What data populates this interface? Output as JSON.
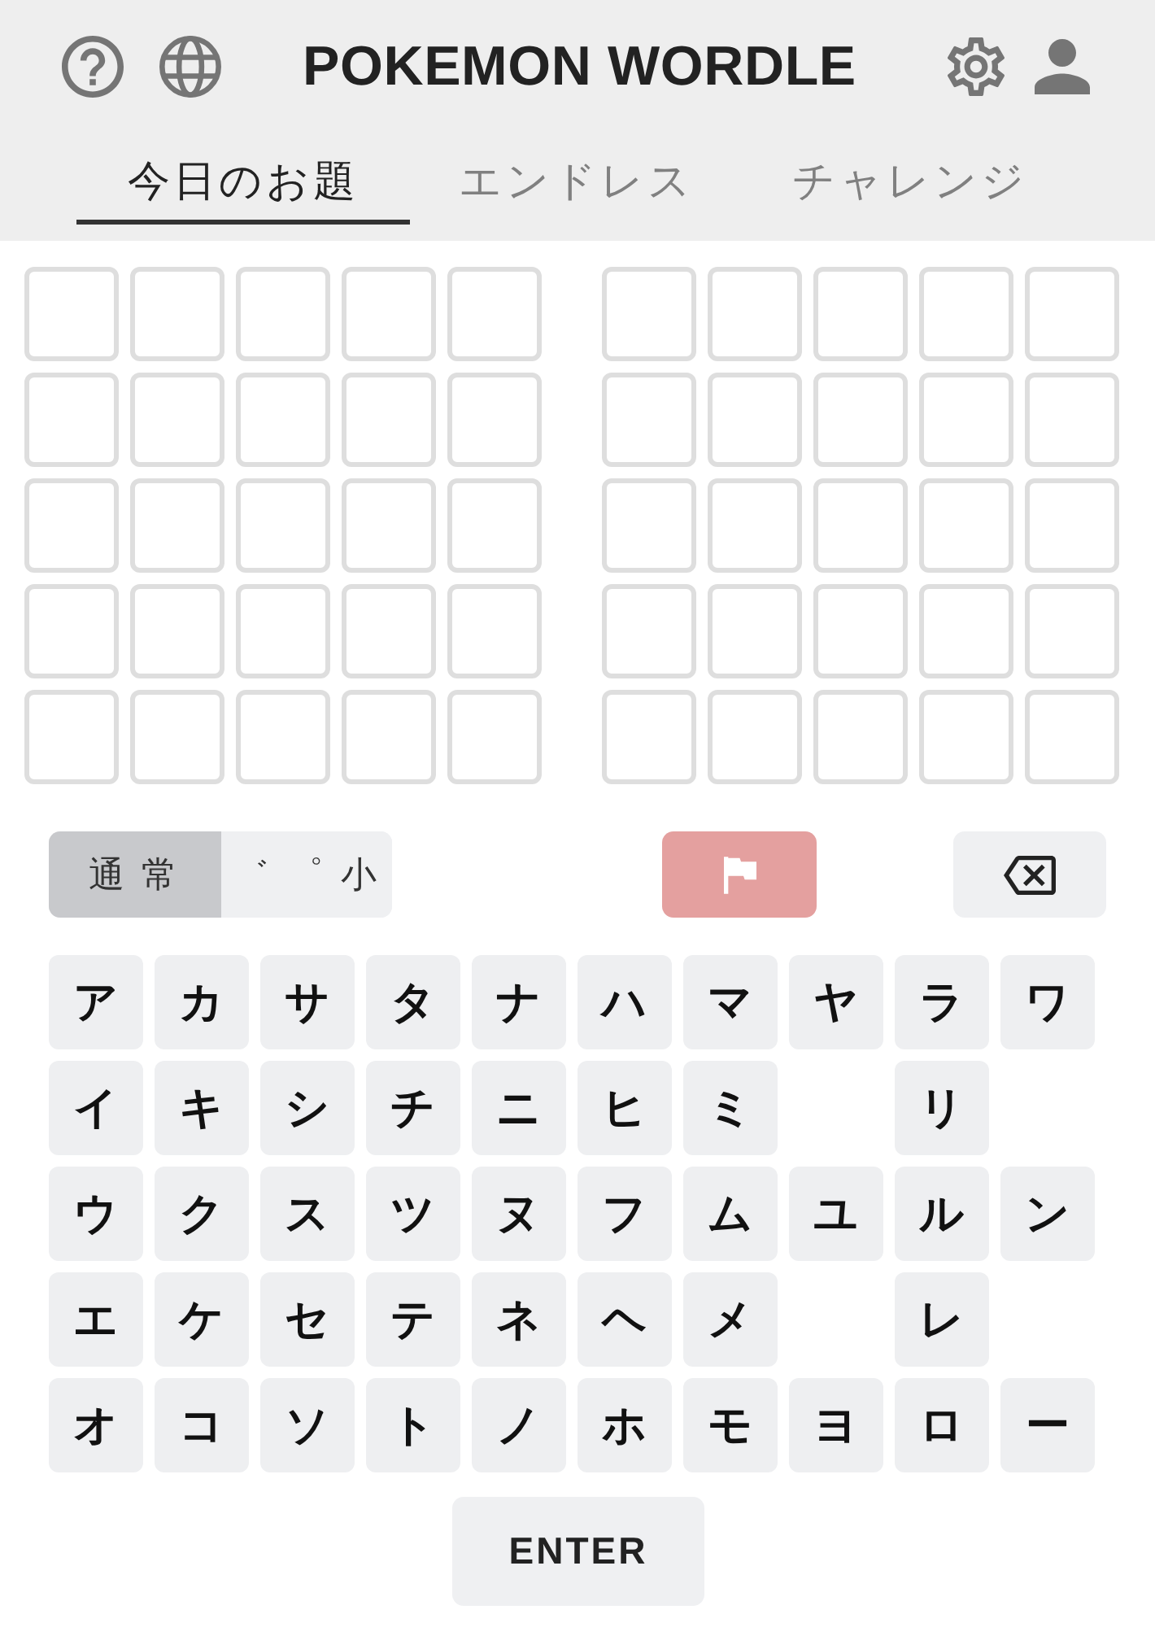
{
  "header": {
    "title": "POKEMON WORDLE"
  },
  "tabs": [
    {
      "label": "今日のお題",
      "selected": true
    },
    {
      "label": "エンドレス",
      "selected": false
    },
    {
      "label": "チャレンジ",
      "selected": false
    }
  ],
  "boards": [
    {
      "rows": [
        [
          {
            "kind": "empty"
          },
          {
            "kind": "empty"
          },
          {
            "kind": "empty"
          },
          {
            "kind": "empty"
          },
          {
            "kind": "empty"
          }
        ],
        [
          {
            "kind": "empty"
          },
          {
            "kind": "empty"
          },
          {
            "kind": "empty"
          },
          {
            "kind": "empty"
          },
          {
            "kind": "empty"
          }
        ],
        [
          {
            "kind": "empty"
          },
          {
            "kind": "empty"
          },
          {
            "kind": "empty"
          },
          {
            "kind": "empty"
          },
          {
            "kind": "empty"
          }
        ],
        [
          {
            "kind": "empty"
          },
          {
            "kind": "empty"
          },
          {
            "kind": "empty"
          },
          {
            "kind": "empty"
          },
          {
            "kind": "empty"
          }
        ],
        [
          {
            "kind": "empty"
          },
          {
            "kind": "empty"
          },
          {
            "kind": "empty"
          },
          {
            "kind": "empty"
          },
          {
            "kind": "empty"
          }
        ]
      ]
    },
    {
      "rows": [
        [
          {
            "kind": "empty"
          },
          {
            "kind": "empty"
          },
          {
            "kind": "empty"
          },
          {
            "kind": "empty"
          },
          {
            "kind": "empty"
          }
        ],
        [
          {
            "kind": "empty"
          },
          {
            "kind": "empty"
          },
          {
            "kind": "empty"
          },
          {
            "kind": "empty"
          },
          {
            "kind": "empty"
          }
        ],
        [
          {
            "kind": "empty"
          },
          {
            "kind": "empty"
          },
          {
            "kind": "empty"
          },
          {
            "kind": "empty"
          },
          {
            "kind": "empty"
          }
        ],
        [
          {
            "kind": "empty"
          },
          {
            "kind": "empty"
          },
          {
            "kind": "empty"
          },
          {
            "kind": "empty"
          },
          {
            "kind": "empty"
          }
        ],
        [
          {
            "kind": "empty"
          },
          {
            "kind": "empty"
          },
          {
            "kind": "empty"
          },
          {
            "kind": "empty"
          },
          {
            "kind": "empty"
          }
        ]
      ]
    }
  ],
  "input_modes": [
    {
      "label": "通 常",
      "selected": true
    },
    {
      "label": "゛ ゜ 小",
      "selected": false
    }
  ],
  "keyboard": {
    "rows": [
      [
        {
          "kind": "key",
          "label": "ア"
        },
        {
          "kind": "key",
          "label": "カ"
        },
        {
          "kind": "key",
          "label": "サ"
        },
        {
          "kind": "key",
          "label": "タ"
        },
        {
          "kind": "key",
          "label": "ナ"
        },
        {
          "kind": "key",
          "label": "ハ"
        },
        {
          "kind": "key",
          "label": "マ"
        },
        {
          "kind": "key",
          "label": "ヤ"
        },
        {
          "kind": "key",
          "label": "ラ"
        },
        {
          "kind": "key",
          "label": "ワ"
        }
      ],
      [
        {
          "kind": "key",
          "label": "イ"
        },
        {
          "kind": "key",
          "label": "キ"
        },
        {
          "kind": "key",
          "label": "シ"
        },
        {
          "kind": "key",
          "label": "チ"
        },
        {
          "kind": "key",
          "label": "ニ"
        },
        {
          "kind": "key",
          "label": "ヒ"
        },
        {
          "kind": "key",
          "label": "ミ"
        },
        {
          "kind": "gap"
        },
        {
          "kind": "key",
          "label": "リ"
        },
        {
          "kind": "gap"
        }
      ],
      [
        {
          "kind": "key",
          "label": "ウ"
        },
        {
          "kind": "key",
          "label": "ク"
        },
        {
          "kind": "key",
          "label": "ス"
        },
        {
          "kind": "key",
          "label": "ツ"
        },
        {
          "kind": "key",
          "label": "ヌ"
        },
        {
          "kind": "key",
          "label": "フ"
        },
        {
          "kind": "key",
          "label": "ム"
        },
        {
          "kind": "key",
          "label": "ユ"
        },
        {
          "kind": "key",
          "label": "ル"
        },
        {
          "kind": "key",
          "label": "ン"
        }
      ],
      [
        {
          "kind": "key",
          "label": "エ"
        },
        {
          "kind": "key",
          "label": "ケ"
        },
        {
          "kind": "key",
          "label": "セ"
        },
        {
          "kind": "key",
          "label": "テ"
        },
        {
          "kind": "key",
          "label": "ネ"
        },
        {
          "kind": "key",
          "label": "ヘ"
        },
        {
          "kind": "key",
          "label": "メ"
        },
        {
          "kind": "gap"
        },
        {
          "kind": "key",
          "label": "レ"
        },
        {
          "kind": "gap"
        }
      ],
      [
        {
          "kind": "key",
          "label": "オ"
        },
        {
          "kind": "key",
          "label": "コ"
        },
        {
          "kind": "key",
          "label": "ソ"
        },
        {
          "kind": "key",
          "label": "ト"
        },
        {
          "kind": "key",
          "label": "ノ"
        },
        {
          "kind": "key",
          "label": "ホ"
        },
        {
          "kind": "key",
          "label": "モ"
        },
        {
          "kind": "key",
          "label": "ヨ"
        },
        {
          "kind": "key",
          "label": "ロ"
        },
        {
          "kind": "key",
          "label": "ー"
        }
      ]
    ],
    "enter_key": {
      "label": "ENTER"
    }
  }
}
